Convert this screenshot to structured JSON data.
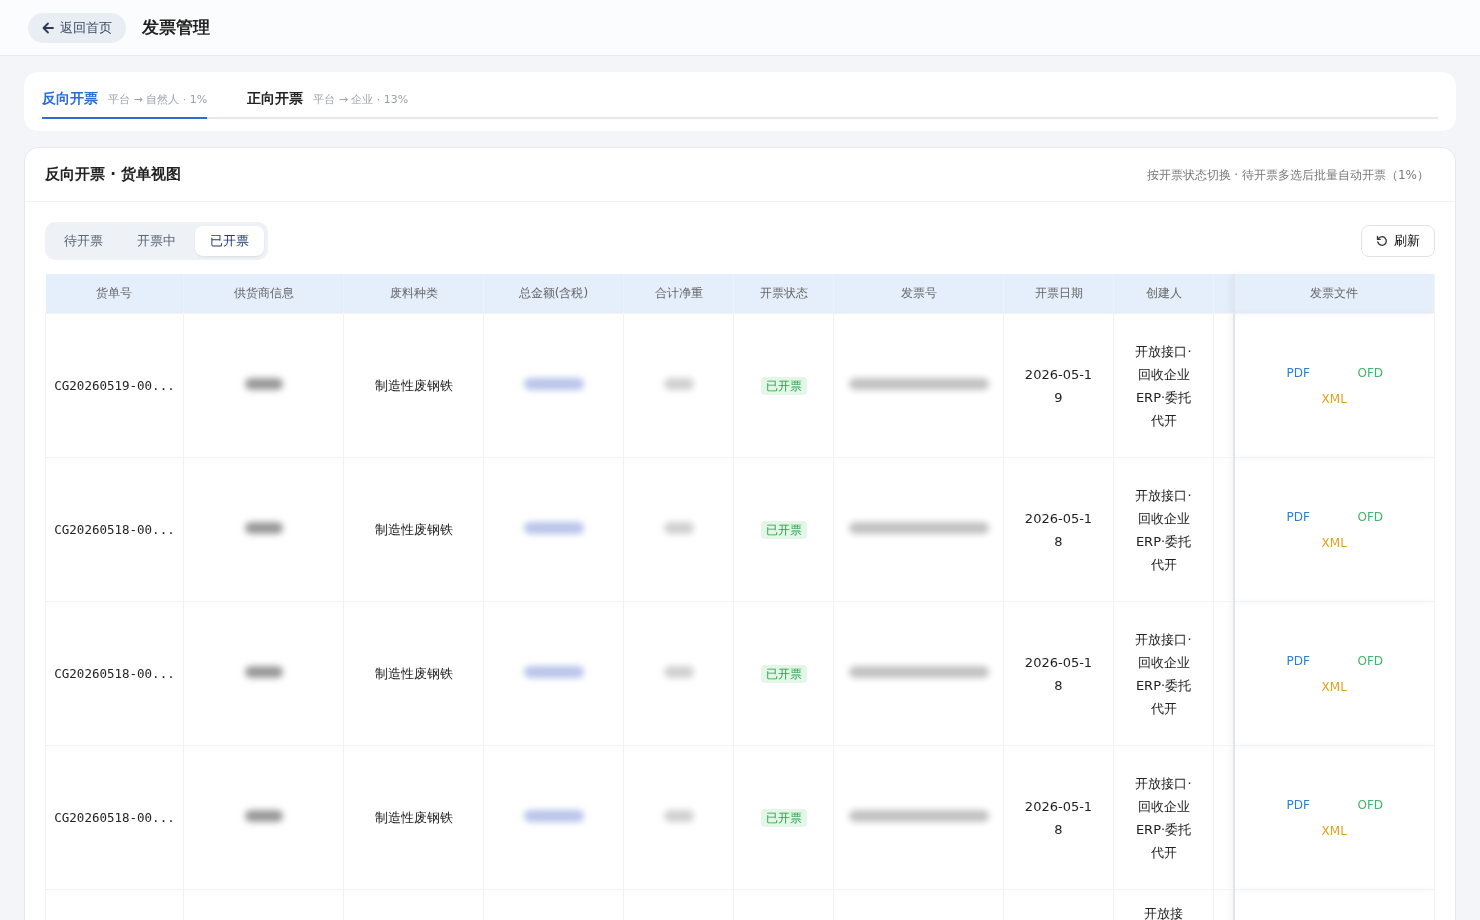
{
  "header": {
    "back_button": "返回首页",
    "title": "发票管理"
  },
  "direction_tabs": [
    {
      "label": "反向开票",
      "detail": "平台 → 自然人 · 1%",
      "selected": true
    },
    {
      "label": "正向开票",
      "detail": "平台 → 企业 · 13%",
      "selected": false
    }
  ],
  "panel": {
    "title": "反向开票 · 货单视图",
    "hint": "按开票状态切换 · 待开票多选后批量自动开票（1%）",
    "status_tabs": [
      {
        "label": "待开票",
        "selected": false
      },
      {
        "label": "开票中",
        "selected": false
      },
      {
        "label": "已开票",
        "selected": true
      }
    ],
    "refresh_button": "刷新",
    "table": {
      "columns": [
        "货单号",
        "供货商信息",
        "废料种类",
        "总金额(含税)",
        "合计净重",
        "开票状态",
        "发票号",
        "开票日期",
        "创建人",
        "发票文件"
      ],
      "rows": [
        {
          "order_no": "CG20260519-00...",
          "waste_type": "制造性废钢铁",
          "status": {
            "label": "已开票",
            "kind": "issued"
          },
          "date": "2026-05-19",
          "creator": "开放接口·回收企业ERP·委托代开",
          "files": [
            {
              "label": "PDF",
              "color": "#2b7fd4"
            },
            {
              "label": "OFD",
              "color": "#3fb56b"
            },
            {
              "label": "XML",
              "color": "#e0a020"
            }
          ]
        },
        {
          "order_no": "CG20260518-00...",
          "waste_type": "制造性废钢铁",
          "status": {
            "label": "已开票",
            "kind": "issued"
          },
          "date": "2026-05-18",
          "creator": "开放接口·回收企业ERP·委托代开",
          "files": [
            {
              "label": "PDF",
              "color": "#2b7fd4"
            },
            {
              "label": "OFD",
              "color": "#3fb56b"
            },
            {
              "label": "XML",
              "color": "#e0a020"
            }
          ]
        },
        {
          "order_no": "CG20260518-00...",
          "waste_type": "制造性废钢铁",
          "status": {
            "label": "已开票",
            "kind": "issued"
          },
          "date": "2026-05-18",
          "creator": "开放接口·回收企业ERP·委托代开",
          "files": [
            {
              "label": "PDF",
              "color": "#2b7fd4"
            },
            {
              "label": "OFD",
              "color": "#3fb56b"
            },
            {
              "label": "XML",
              "color": "#e0a020"
            }
          ]
        },
        {
          "order_no": "CG20260518-00...",
          "waste_type": "制造性废钢铁",
          "status": {
            "label": "已开票",
            "kind": "issued"
          },
          "date": "2026-05-18",
          "creator": "开放接口·回收企业ERP·委托代开",
          "files": [
            {
              "label": "PDF",
              "color": "#2b7fd4"
            },
            {
              "label": "OFD",
              "color": "#3fb56b"
            },
            {
              "label": "XML",
              "color": "#e0a020"
            }
          ]
        },
        {
          "creator": "开放接"
        }
      ]
    }
  }
}
